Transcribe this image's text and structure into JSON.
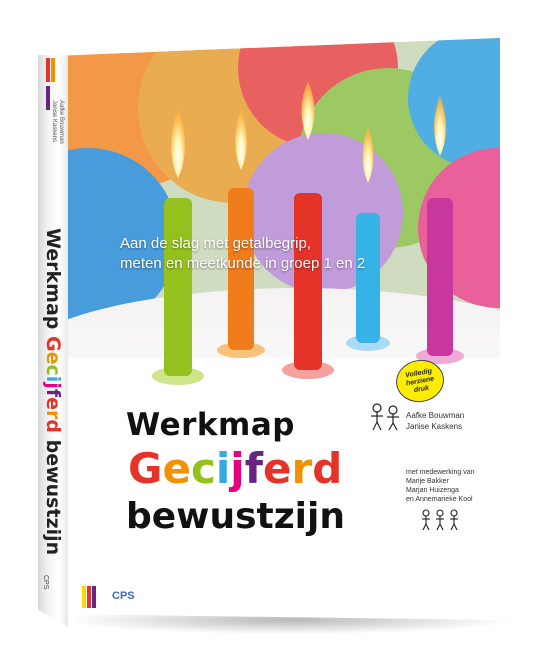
{
  "cover": {
    "subtitle_line1": "Aan de slag met getalbegrip,",
    "subtitle_line2": "meten en meetkunde in groep 1 en 2",
    "title_line1": "Werkmap",
    "title_word2_letters": [
      "G",
      "e",
      "c",
      "i",
      "j",
      "f",
      "e",
      "r",
      "d"
    ],
    "title_word2_colors": [
      "#e6332a",
      "#f39200",
      "#95c11f",
      "#36a9e1",
      "#e5007d",
      "#662483",
      "#e6332a",
      "#f39200",
      "#e6332a"
    ],
    "title_line3": "bewustzijn",
    "badge_line1": "Volledig",
    "badge_line2": "herziene",
    "badge_line3": "druk",
    "author1": "Aafke Bouwman",
    "author2": "Janise Kaskens",
    "contrib_intro": "met medewerking van",
    "contrib1": "Marije Bakker",
    "contrib2": "Marjan Huizenga",
    "contrib3": "en Annemarieke Kool",
    "publisher": "CPS"
  },
  "spine": {
    "authors_line1": "Aafke Bouwman",
    "authors_line2": "Janise Kaskens",
    "title_word1": "Werkmap",
    "title_word2": "Gecijferd",
    "title_word3": "bewustzijn",
    "publisher": "CPS"
  },
  "colors": {
    "red": "#e6332a",
    "orange": "#f39200",
    "green": "#95c11f",
    "blue": "#36a9e1",
    "magenta": "#e5007d",
    "purple": "#662483",
    "badge_yellow": "#ffed00"
  },
  "icons": [
    "kids-drawing-icon",
    "cps-logo-icon"
  ]
}
